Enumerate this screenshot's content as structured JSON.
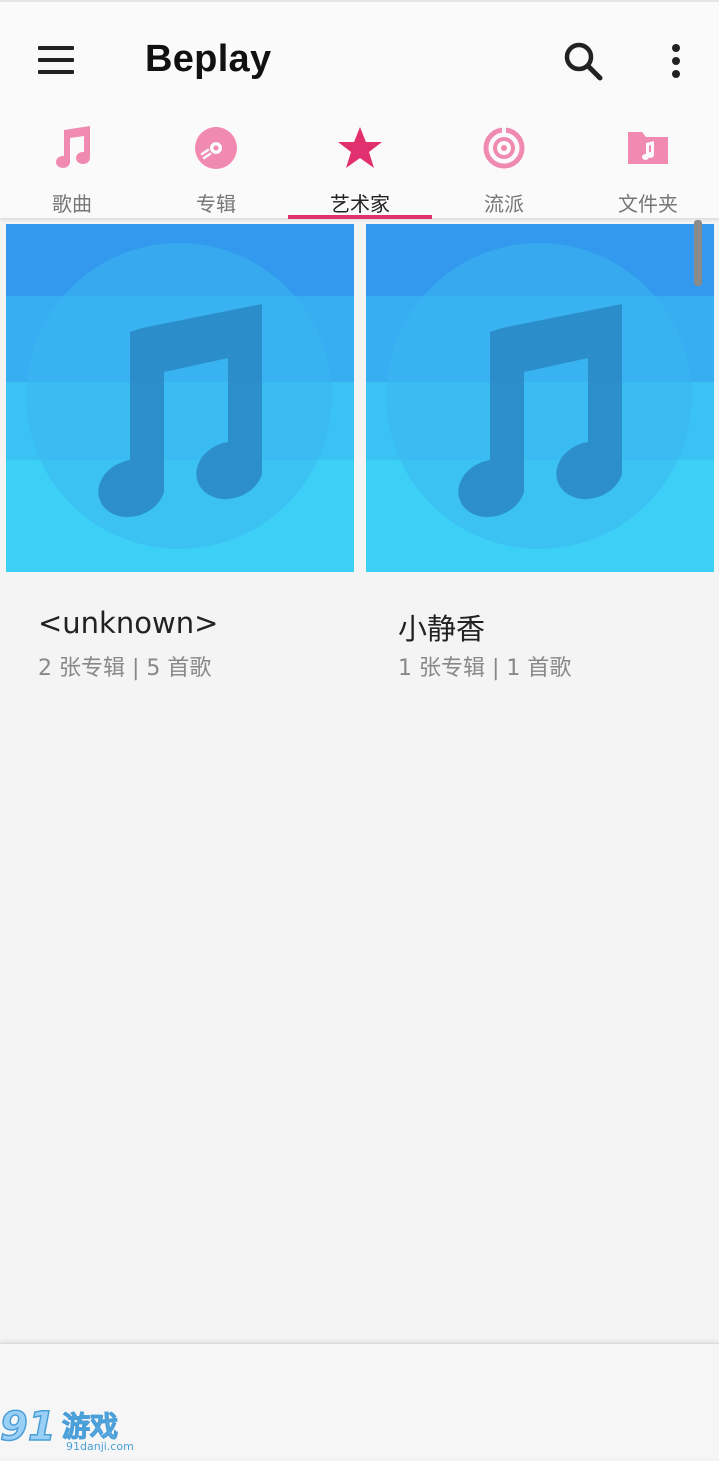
{
  "app_bar": {
    "title": "Beplay",
    "menu_icon": "hamburger-menu-icon",
    "search_icon": "search-icon",
    "more_icon": "more-vert-icon"
  },
  "tabs": [
    {
      "label": "歌曲",
      "icon": "music-note-icon",
      "active": false
    },
    {
      "label": "专辑",
      "icon": "album-disc-icon",
      "active": false
    },
    {
      "label": "艺术家",
      "icon": "star-icon",
      "active": true
    },
    {
      "label": "流派",
      "icon": "genre-target-icon",
      "active": false
    },
    {
      "label": "文件夹",
      "icon": "music-folder-icon",
      "active": false
    }
  ],
  "colors": {
    "accent": "#e0306e",
    "tab_icon_inactive": "#f08ab0",
    "art_top": "#3399ee",
    "art_bottom": "#3fd6f8",
    "art_note": "#2a86c4"
  },
  "artists": [
    {
      "name": "<unknown>",
      "meta": "2 张专辑 | 5 首歌"
    },
    {
      "name": "小静香",
      "meta": "1 张专辑 | 1 首歌"
    }
  ],
  "watermark": {
    "brand": "91游戏",
    "domain": "91danji.com"
  }
}
